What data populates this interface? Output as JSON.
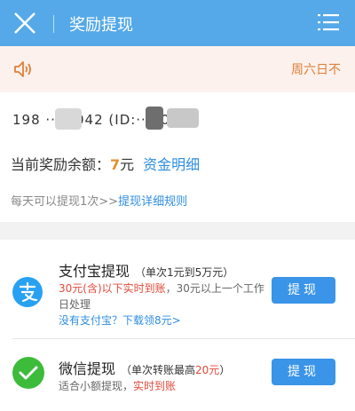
{
  "header": {
    "title": "奖励提现"
  },
  "notice": {
    "text": "周六日不"
  },
  "account": {
    "masked_text": "198 ··· 0042 (ID:···0030)"
  },
  "balance": {
    "label": "当前奖励余额：",
    "value": "7",
    "unit": "元",
    "detail_link": "资金明细"
  },
  "rule": {
    "prefix": "每天可以提现1次>>",
    "link": "提现详细规则"
  },
  "methods": {
    "alipay": {
      "title": "支付宝提现",
      "limit": "（单次1元到5万元）",
      "desc_red": "30元(含)以下实时到账",
      "desc_rest": "，30元以上一个工作日处理",
      "desc_link": "没有支付宝？下载领8元>",
      "button": "提现"
    },
    "wechat": {
      "title": "微信提现",
      "limit_prefix": "（单次转账最高",
      "limit_red": "20元",
      "limit_suffix": "）",
      "desc_prefix": "适合小额提现，",
      "desc_red": "实时到账",
      "button": "提现"
    }
  },
  "colors": {
    "header": "#55a9e8",
    "accent_blue": "#2f8ee0",
    "button": "#3a94e8",
    "red": "#e04a3a",
    "orange": "#e07f3a"
  },
  "icons": [
    "close-icon",
    "menu-icon",
    "speaker-icon",
    "alipay-icon",
    "wechat-pay-icon"
  ]
}
